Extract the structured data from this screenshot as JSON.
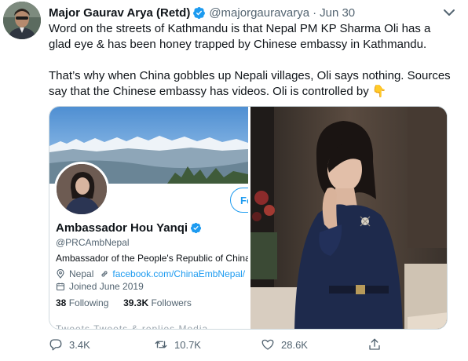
{
  "tweet": {
    "author_name": "Major Gaurav Arya (Retd)",
    "handle": "@majorgauravarya",
    "separator": "·",
    "date": "Jun 30",
    "text_lines": [
      "Word on the streets of Kathmandu is that Nepal PM KP Sharma Oli has a",
      "glad eye & has been honey trapped by Chinese embassy in Kathmandu.",
      "That’s why when China gobbles up Nepali villages, Oli says nothing. Sources",
      "say that the Chinese embassy has videos. Oli is controlled by"
    ],
    "emoji": "👇"
  },
  "embedded_profile": {
    "name": "Ambassador Hou Yanqi",
    "handle": "@PRCAmbNepal",
    "bio": "Ambassador of the People's Republic of China tc",
    "location": "Nepal",
    "link": "facebook.com/ChinaEmbNepal/",
    "joined": "Joined June 2019",
    "following_count": "38",
    "following_label": "Following",
    "followers_count": "39.3K",
    "followers_label": "Followers",
    "follow_button": "Fo",
    "tabs_cut": "Tweets    Tweets & replies    Media"
  },
  "actions": {
    "reply_count": "3.4K",
    "retweet_count": "10.7K",
    "like_count": "28.6K"
  },
  "colors": {
    "accent": "#1d9bf0",
    "text": "#0f1419",
    "muted": "#536471"
  },
  "icons": [
    "verified-badge-icon",
    "more-icon",
    "reply-icon",
    "retweet-icon",
    "like-icon",
    "share-icon",
    "location-icon",
    "link-icon",
    "calendar-icon"
  ]
}
